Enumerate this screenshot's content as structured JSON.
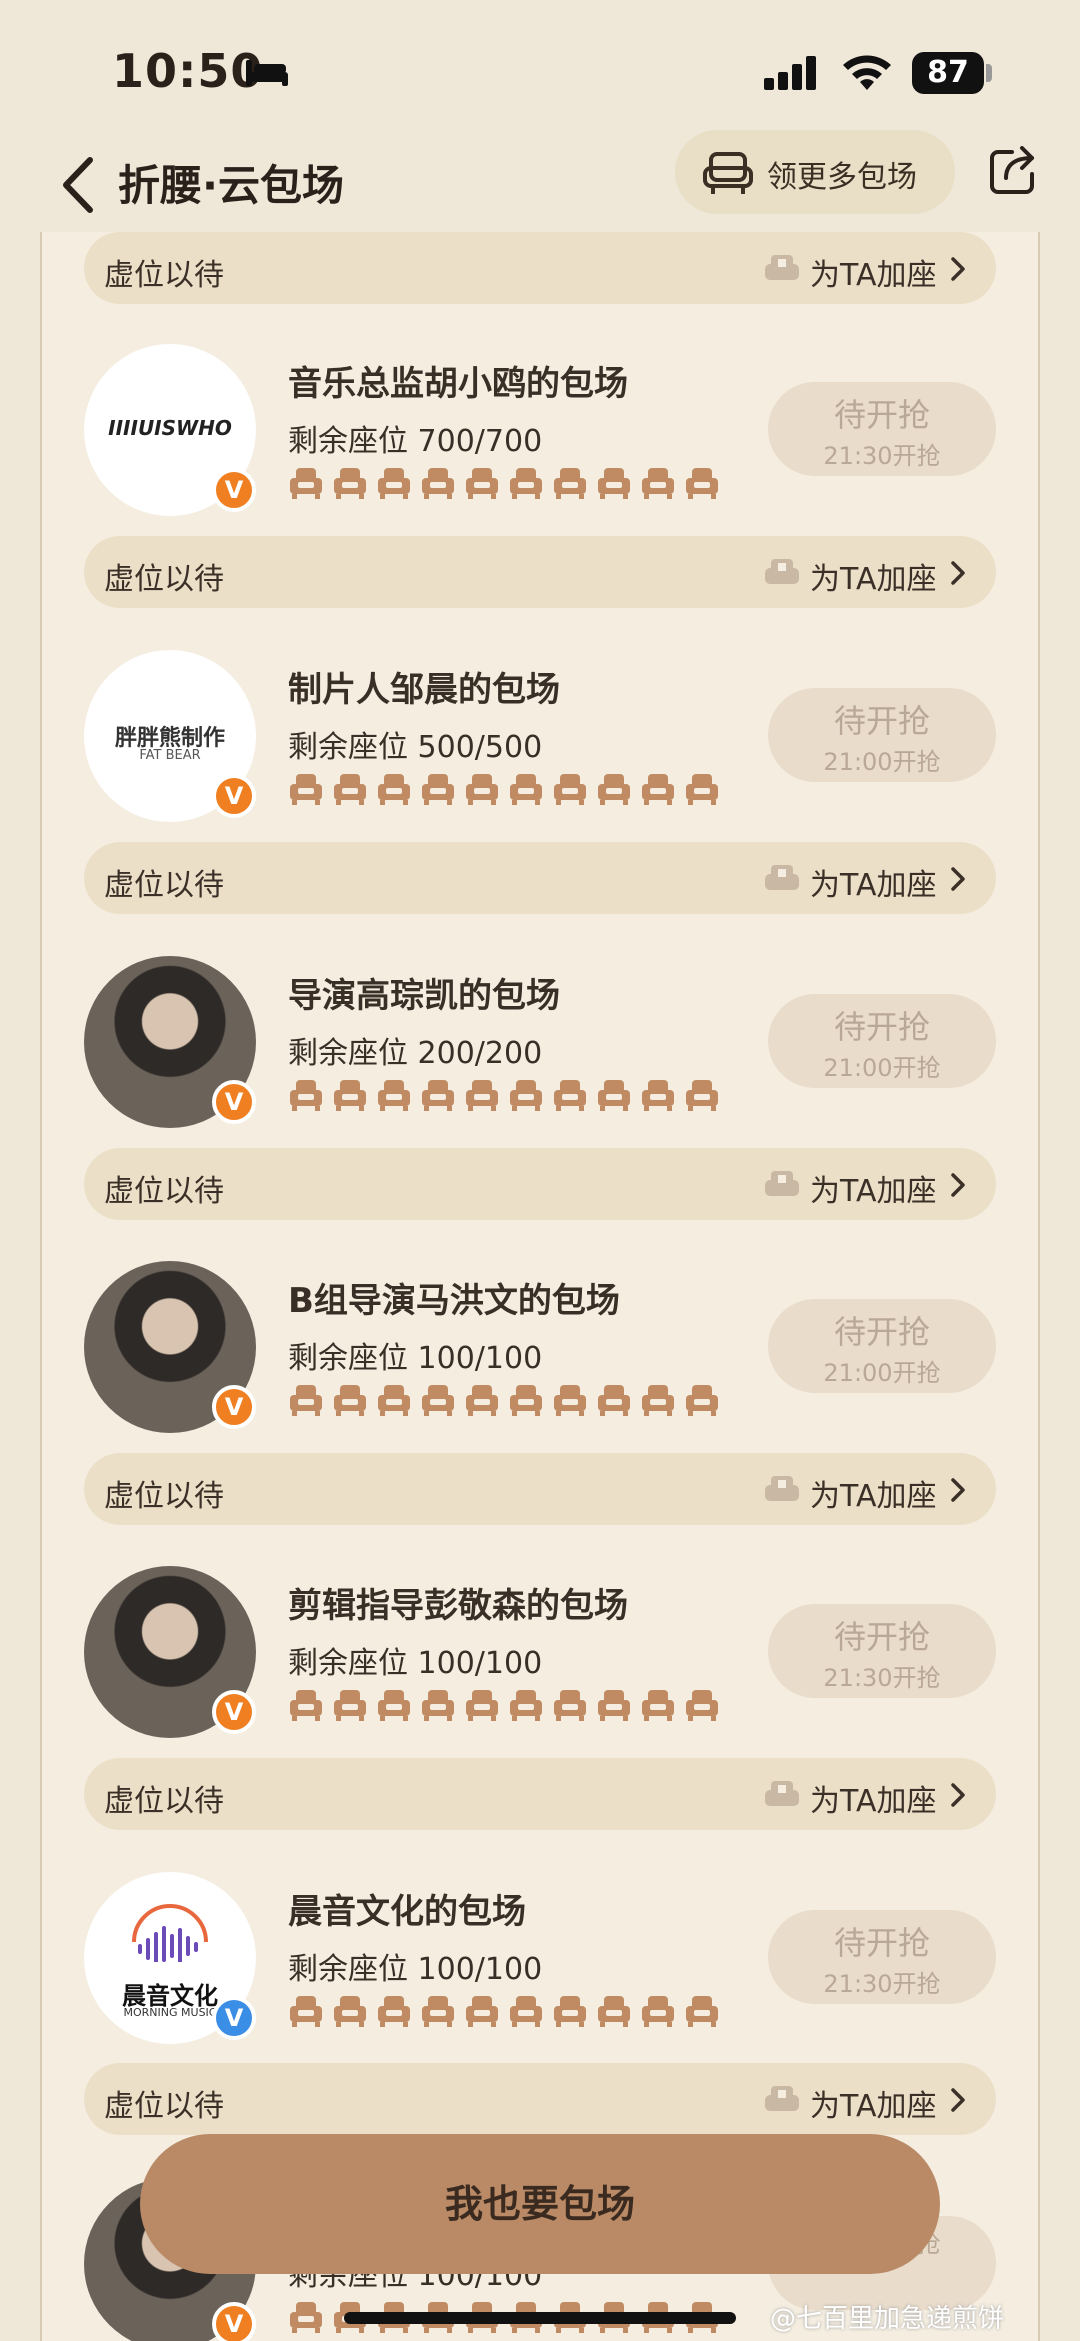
{
  "status_bar": {
    "time": "10:50",
    "battery": "87"
  },
  "nav": {
    "title": "折腰·云包场",
    "more_label": "领更多包场"
  },
  "queue_label": "虚位以待",
  "queue_action": "为TA加座",
  "cards": [
    {
      "title": "音乐总监胡小鸥的包场",
      "seats": "剩余座位 700/700",
      "status": "待开抢",
      "time": "21:30开抢",
      "logo": "IIIIUISWHO",
      "badge": "V"
    },
    {
      "title": "制片人邹晨的包场",
      "seats": "剩余座位 500/500",
      "status": "待开抢",
      "time": "21:00开抢",
      "logo": "胖胖熊制作",
      "logo_sub": "FAT BEAR",
      "badge": "V"
    },
    {
      "title": "导演高琮凯的包场",
      "seats": "剩余座位 200/200",
      "status": "待开抢",
      "time": "21:00开抢",
      "badge": "V"
    },
    {
      "title": "B组导演马洪文的包场",
      "seats": "剩余座位 100/100",
      "status": "待开抢",
      "time": "21:00开抢",
      "badge": "V"
    },
    {
      "title": "剪辑指导彭敬森的包场",
      "seats": "剩余座位 100/100",
      "status": "待开抢",
      "time": "21:30开抢",
      "badge": "V"
    },
    {
      "title": "晨音文化的包场",
      "seats": "剩余座位 100/100",
      "status": "待开抢",
      "time": "21:30开抢",
      "logo": "晨音文化",
      "logo_sub": "MORNING MUSIC",
      "badge": "V"
    },
    {
      "title": "",
      "seats": "剩余座位 100/100",
      "status": "",
      "time": "21:30开抢",
      "badge": "V"
    }
  ],
  "cta_label": "我也要包场",
  "watermark": "@七百里加急递煎饼",
  "colors": {
    "background": "#efe7d8",
    "accent_brown": "#b98a65",
    "seat_icon": "#c08a62",
    "badge_orange": "#ef7f21",
    "badge_blue": "#3a8ee6"
  }
}
